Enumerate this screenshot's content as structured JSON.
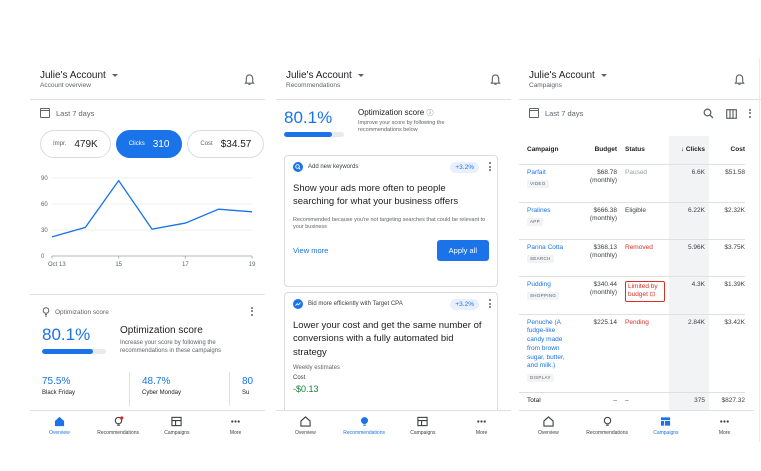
{
  "colors": {
    "accent": "#1a73e8",
    "negative": "#d93025",
    "positive": "#188038"
  },
  "screen1": {
    "header": {
      "title": "Julie's Account",
      "subtitle": "Account overview"
    },
    "date_range": "Last 7 days",
    "pills": [
      {
        "label": "Impr.",
        "value": "479K"
      },
      {
        "label": "Clicks",
        "value": "310"
      },
      {
        "label": "Cost",
        "value": "$34.57"
      }
    ],
    "chart_data": {
      "type": "line",
      "x": [
        "Oct 13",
        "14",
        "15",
        "16",
        "17",
        "18",
        "19"
      ],
      "x_tick_labels": [
        "Oct 13",
        "15",
        "17",
        "19"
      ],
      "series": [
        {
          "values": [
            22,
            33,
            87,
            31,
            38,
            54,
            51
          ]
        }
      ],
      "y_ticks": [
        "0",
        "30",
        "60",
        "90"
      ],
      "ylim": [
        0,
        90
      ]
    },
    "opt_section": {
      "header": "Optimization score",
      "percent": "80.1%",
      "score": 0.801,
      "title": "Optimization score",
      "description": "Increase your score by following the recommendations in these campaigns"
    },
    "metric_cards": [
      {
        "value": "75.5%",
        "label": "Black Friday"
      },
      {
        "value": "48.7%",
        "label": "Cyber Monday"
      },
      {
        "value": "80",
        "label": "Su"
      }
    ]
  },
  "screen2": {
    "header": {
      "title": "Julie's Account",
      "subtitle": "Recommendations"
    },
    "opt": {
      "percent": "80.1%",
      "score": 0.801,
      "title": "Optimization score",
      "description": "Improve your score by following the recommendations below"
    },
    "card1": {
      "category": "Add new keywords",
      "badge": "+3.2%",
      "title": "Show your ads more often to people searching for what your business offers",
      "description": "Recommended because you're not targeting searches that could be relevant to your business",
      "view_more": "View more",
      "apply": "Apply all"
    },
    "card2": {
      "category": "Bid more efficiently with Target CPA",
      "badge": "+3.2%",
      "title": "Lower your cost and get the same number of conversions with a fully automated bid strategy",
      "weekly": "Weekly estimates",
      "cost_label": "Cost",
      "cost_value": "-$0.13"
    }
  },
  "screen3": {
    "header": {
      "title": "Julie's Account",
      "subtitle": "Campaigns"
    },
    "date_range": "Last 7 days",
    "columns": {
      "campaign": "Campaign",
      "budget": "Budget",
      "status": "Status",
      "clicks": "Clicks",
      "cost": "Cost"
    },
    "rows": [
      {
        "name": "Parfait",
        "tag": "VIDEO",
        "budget": "$68.78 (monthly)",
        "status": "Paused",
        "clicks": "6.6K",
        "cost": "$51.58"
      },
      {
        "name": "Pralines",
        "tag": "APP",
        "budget": "$666.38 (monthly)",
        "status": "Eligible",
        "clicks": "6.22K",
        "cost": "$2.32K"
      },
      {
        "name": "Panna Cotta",
        "tag": "SEARCH",
        "budget": "$368.13 (monthly)",
        "status": "Removed",
        "clicks": "5.96K",
        "cost": "$3.75K"
      },
      {
        "name": "Pudding",
        "tag": "SHOPPING",
        "budget": "$340.44 (monthly)",
        "status": "Limited by budget",
        "clicks": "4.3K",
        "cost": "$1.39K"
      },
      {
        "name": "Penuche (A fudge-like candy made from brown sugar, butter, and milk.)",
        "tag": "DISPLAY",
        "budget": "$225.14",
        "status": "Pending",
        "clicks": "2.84K",
        "cost": "$3.42K"
      }
    ],
    "total": {
      "label": "Total",
      "budget": "–",
      "status": "–",
      "clicks": "375",
      "cost": "$827.32"
    }
  },
  "nav": {
    "overview": "Overview",
    "recommendations": "Recommendations",
    "campaigns": "Campaigns",
    "more": "More"
  }
}
